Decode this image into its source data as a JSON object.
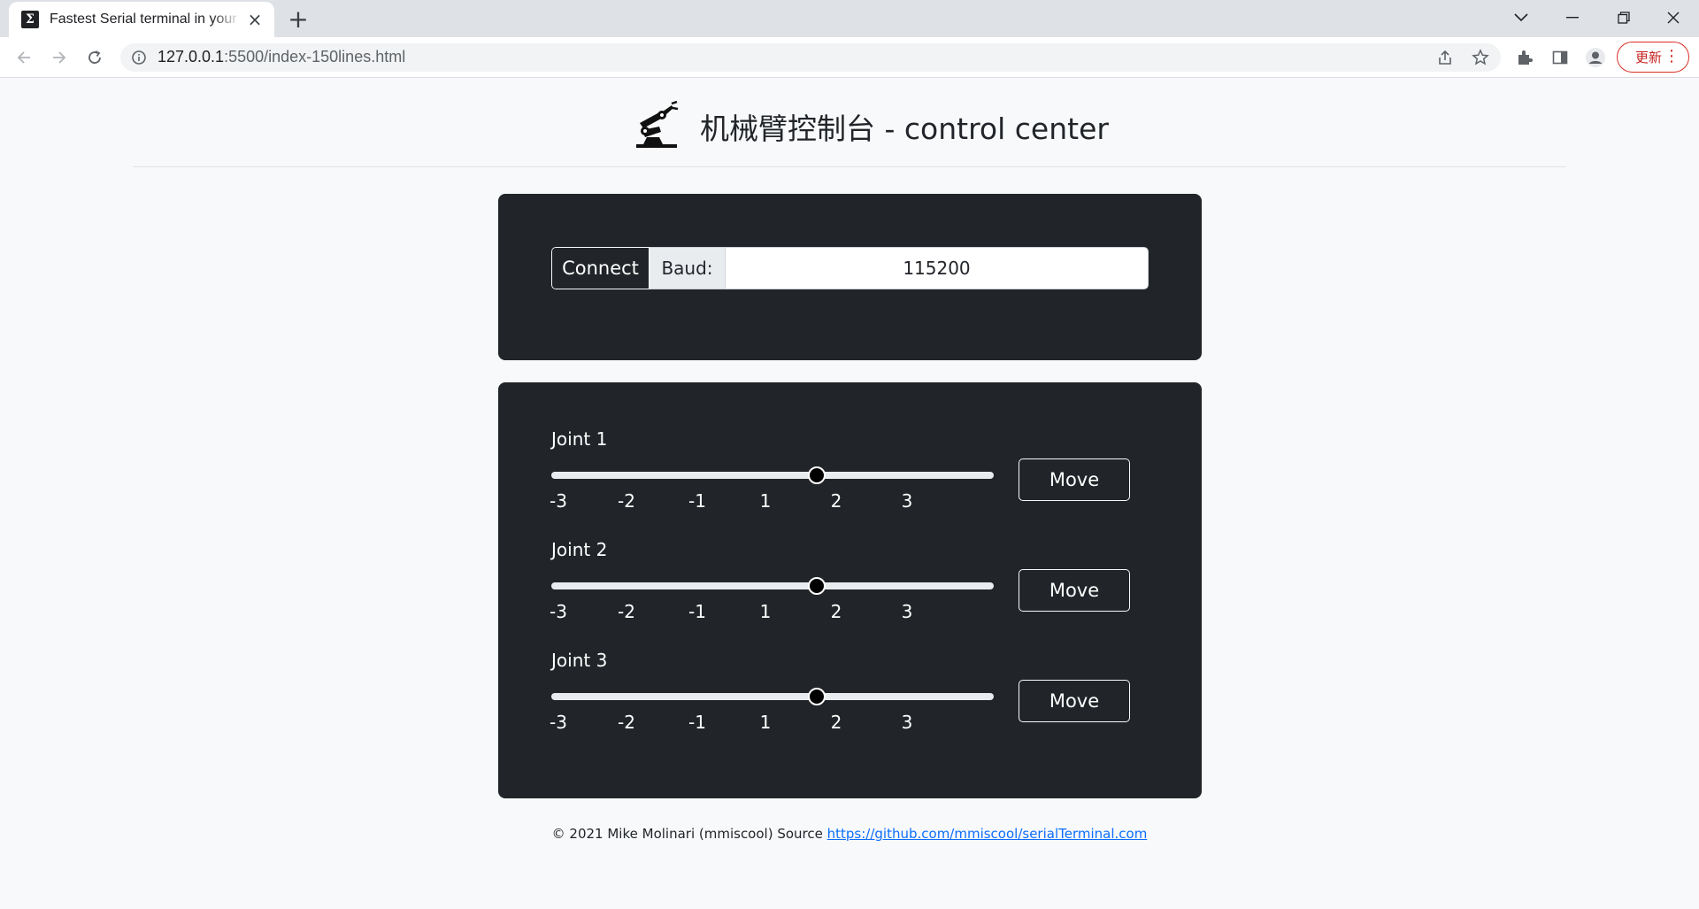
{
  "browser": {
    "tab_title": "Fastest Serial terminal in your browser",
    "tab_favicon": "Σ",
    "url_host": "127.0.0.1",
    "url_path": ":5500/index-150lines.html",
    "update_label": "更新",
    "icons": [
      "back-icon",
      "forward-icon",
      "reload-icon",
      "info-icon",
      "share-icon",
      "star-icon",
      "extensions-icon",
      "sidepanel-icon",
      "profile-icon",
      "more-icon"
    ]
  },
  "header": {
    "title": "机械臂控制台 - control center",
    "logo_icon": "robot-arm-icon"
  },
  "connect": {
    "button_label": "Connect",
    "baud_label": "Baud:",
    "baud_value": "115200"
  },
  "joints": [
    {
      "label": "Joint 1",
      "min": -3,
      "max": 3,
      "value_fraction": 0.6,
      "ticks": [
        "-3",
        "-2",
        "-1",
        "1",
        "2",
        "3"
      ],
      "move_label": "Move"
    },
    {
      "label": "Joint 2",
      "min": -3,
      "max": 3,
      "value_fraction": 0.6,
      "ticks": [
        "-3",
        "-2",
        "-1",
        "1",
        "2",
        "3"
      ],
      "move_label": "Move"
    },
    {
      "label": "Joint 3",
      "min": -3,
      "max": 3,
      "value_fraction": 0.6,
      "ticks": [
        "-3",
        "-2",
        "-1",
        "1",
        "2",
        "3"
      ],
      "move_label": "Move"
    }
  ],
  "footer": {
    "text": "© 2021 Mike Molinari (mmiscool) Source ",
    "link_text": "https://github.com/mmiscool/serialTerminal.com"
  },
  "colors": {
    "card_bg": "#212529",
    "page_bg": "#f8f9fa",
    "link": "#0d6efd",
    "update_accent": "#d93025"
  }
}
